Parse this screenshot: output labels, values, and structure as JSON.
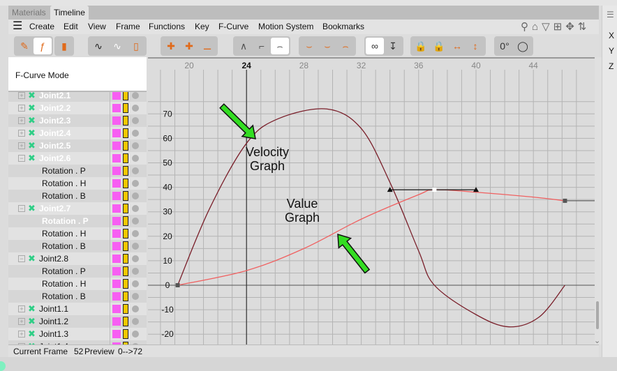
{
  "tabs": [
    {
      "label": "Materials",
      "active": false
    },
    {
      "label": "Timeline",
      "active": true
    }
  ],
  "menu": [
    "Create",
    "Edit",
    "View",
    "Frame",
    "Functions",
    "Key",
    "F-Curve",
    "Motion System",
    "Bookmarks"
  ],
  "mode_label": "F-Curve Mode",
  "tree": [
    {
      "label": "Joint2.1",
      "type": "joint",
      "expander": "plus",
      "highlight": true
    },
    {
      "label": "Joint2.2",
      "type": "joint",
      "expander": "plus",
      "highlight": true
    },
    {
      "label": "Joint2.3",
      "type": "joint",
      "expander": "plus",
      "highlight": true
    },
    {
      "label": "Joint2.4",
      "type": "joint",
      "expander": "plus",
      "highlight": true
    },
    {
      "label": "Joint2.5",
      "type": "joint",
      "expander": "plus",
      "highlight": true
    },
    {
      "label": "Joint2.6",
      "type": "joint",
      "expander": "minus",
      "highlight": true
    },
    {
      "label": "Rotation . P",
      "type": "track",
      "highlight": false
    },
    {
      "label": "Rotation . H",
      "type": "track",
      "highlight": false
    },
    {
      "label": "Rotation . B",
      "type": "track",
      "highlight": false
    },
    {
      "label": "Joint2.7",
      "type": "joint",
      "expander": "minus",
      "highlight": true
    },
    {
      "label": "Rotation . P",
      "type": "track",
      "highlight": true
    },
    {
      "label": "Rotation . H",
      "type": "track",
      "highlight": false
    },
    {
      "label": "Rotation . B",
      "type": "track",
      "highlight": false
    },
    {
      "label": "Joint2.8",
      "type": "joint",
      "expander": "minus",
      "highlight": false
    },
    {
      "label": "Rotation . P",
      "type": "track",
      "highlight": false
    },
    {
      "label": "Rotation . H",
      "type": "track",
      "highlight": false
    },
    {
      "label": "Rotation . B",
      "type": "track",
      "highlight": false
    },
    {
      "label": "Joint1.1",
      "type": "joint",
      "expander": "plus",
      "highlight": false
    },
    {
      "label": "Joint1.2",
      "type": "joint",
      "expander": "plus",
      "highlight": false
    },
    {
      "label": "Joint1.3",
      "type": "joint",
      "expander": "plus",
      "highlight": false
    },
    {
      "label": "Joint1.4",
      "type": "joint",
      "expander": "plus",
      "highlight": false
    }
  ],
  "colors": {
    "swatch": "#f75ef2",
    "velocity": "#7a1f2a",
    "value": "#f06060",
    "arrow": "#33dd22"
  },
  "ruler": {
    "ticks": [
      "20",
      "24",
      "28",
      "32",
      "36",
      "40",
      "44"
    ],
    "current": "24"
  },
  "y_axis_labels": [
    "70",
    "60",
    "50",
    "40",
    "30",
    "20",
    "10",
    "0",
    "-10",
    "-20"
  ],
  "annotations": {
    "velocity": [
      "Velocity",
      "Graph"
    ],
    "value": [
      "Value",
      "Graph"
    ]
  },
  "right_panel": [
    "X",
    "Y",
    "Z"
  ],
  "status": {
    "frame_label": "Current Frame",
    "frame": "52",
    "preview_label": "Preview",
    "preview": "0-->72"
  },
  "chart_data": {
    "type": "line",
    "x_range": [
      16.6,
      47.8
    ],
    "y_range": [
      -23,
      79
    ],
    "grid": true,
    "current_frame": 24,
    "series": [
      {
        "name": "Velocity Graph",
        "points": [
          [
            19.2,
            0
          ],
          [
            21.4,
            31
          ],
          [
            24,
            58
          ],
          [
            26.2,
            68
          ],
          [
            29.6,
            72
          ],
          [
            32,
            64
          ],
          [
            34,
            42
          ],
          [
            36,
            14
          ],
          [
            37.1,
            0
          ],
          [
            40,
            -12
          ],
          [
            42.3,
            -17
          ],
          [
            44.4,
            -13
          ],
          [
            46.2,
            0
          ]
        ]
      },
      {
        "name": "Value Graph",
        "points": [
          [
            19.2,
            0
          ],
          [
            24,
            6
          ],
          [
            28,
            15
          ],
          [
            32,
            27
          ],
          [
            36,
            37
          ],
          [
            37.1,
            39
          ],
          [
            40,
            38
          ],
          [
            44,
            36
          ],
          [
            46.2,
            34.5
          ]
        ],
        "keys": [
          [
            19.2,
            0
          ],
          [
            37.1,
            39
          ],
          [
            46.2,
            34.5
          ]
        ],
        "tangent_handles": [
          [
            34,
            39
          ],
          [
            40,
            39
          ]
        ]
      }
    ]
  }
}
